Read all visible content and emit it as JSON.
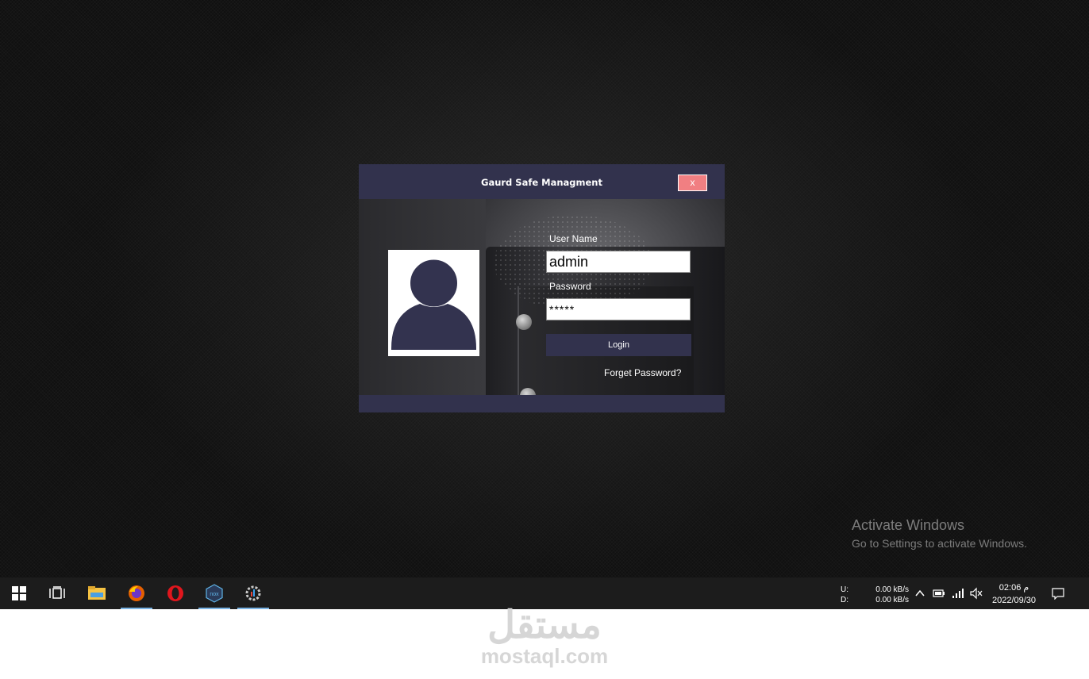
{
  "window": {
    "title": "Gaurd Safe Managment",
    "close_label": "x",
    "username_label": "User Name",
    "username_value": "admin",
    "password_label": "Password",
    "password_value": "*****",
    "login_label": "Login",
    "forget_label": "Forget Password?"
  },
  "activation": {
    "title": "Activate Windows",
    "subtitle": "Go to Settings to activate Windows."
  },
  "taskbar": {
    "apps": [
      {
        "icon": "windows-start-icon"
      },
      {
        "icon": "task-view-icon"
      },
      {
        "icon": "file-explorer-icon"
      },
      {
        "icon": "firefox-icon",
        "active": true
      },
      {
        "icon": "opera-icon"
      },
      {
        "icon": "nox-player-icon",
        "active": true
      },
      {
        "icon": "app-settings-icon",
        "active": true
      }
    ],
    "net_labels": "U:\nD:",
    "upload_speed": "0.00 kB/s",
    "download_speed": "0.00 kB/s",
    "time": "02:06 م",
    "date": "2022/09/30",
    "tray_icons": [
      "chevron-up-icon",
      "battery-icon",
      "signal-icon",
      "volume-muted-icon",
      "notifications-icon"
    ]
  },
  "watermark": {
    "arabic": "مستقل",
    "english": "mostaql.com"
  },
  "colors": {
    "window_bar": "#32324d",
    "close_button": "#f17f82",
    "avatar": "#33334f"
  }
}
